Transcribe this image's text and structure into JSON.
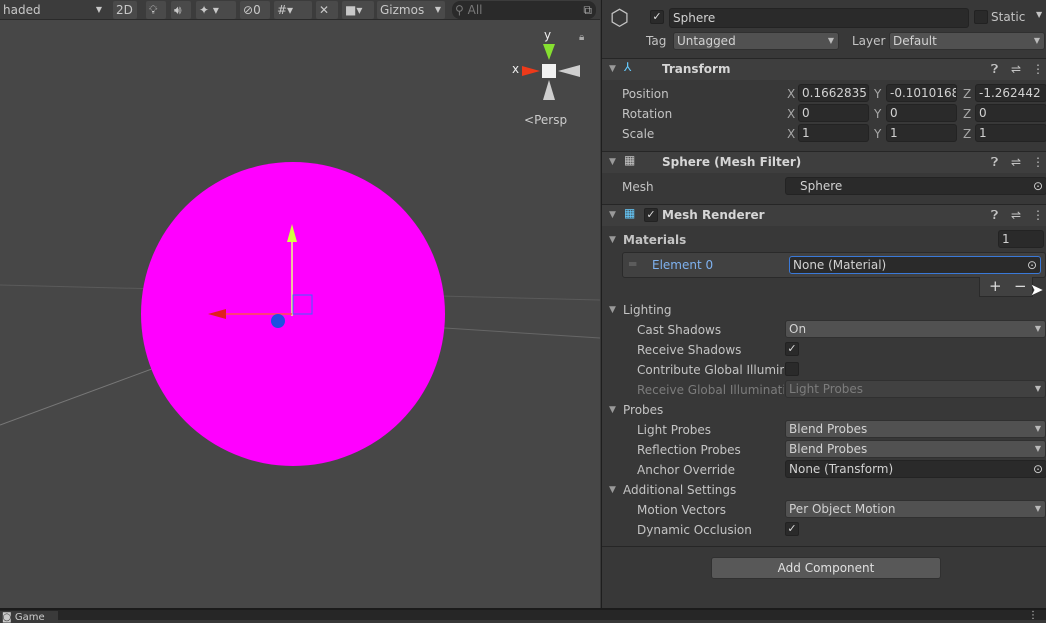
{
  "toolbar": {
    "shading": "haded",
    "mode_2d": "2D",
    "hidden_count": "0",
    "gizmos": "Gizmos",
    "search_placeholder": "All"
  },
  "scene": {
    "gizmo_y": "y",
    "gizmo_x": "x",
    "projection": "Persp",
    "sphere_color": "#ff00ff"
  },
  "object": {
    "active": true,
    "name": "Sphere",
    "static_label": "Static",
    "static": false,
    "tag_label": "Tag",
    "tag": "Untagged",
    "layer_label": "Layer",
    "layer": "Default"
  },
  "transform": {
    "title": "Transform",
    "rows": [
      {
        "label": "Position",
        "x": "0.1662835",
        "y": "-0.1010168",
        "z": "-1.262442"
      },
      {
        "label": "Rotation",
        "x": "0",
        "y": "0",
        "z": "0"
      },
      {
        "label": "Scale",
        "x": "1",
        "y": "1",
        "z": "1"
      }
    ],
    "axis_x": "X",
    "axis_y": "Y",
    "axis_z": "Z"
  },
  "mesh_filter": {
    "title": "Sphere (Mesh Filter)",
    "mesh_label": "Mesh",
    "mesh": "Sphere"
  },
  "mesh_renderer": {
    "title": "Mesh Renderer",
    "enabled": true,
    "materials_label": "Materials",
    "materials_count": "1",
    "element_label": "Element 0",
    "element_value": "None (Material)",
    "add": "+",
    "remove": "−",
    "lighting_label": "Lighting",
    "cast_shadows_label": "Cast Shadows",
    "cast_shadows": "On",
    "receive_shadows_label": "Receive Shadows",
    "receive_shadows": true,
    "contribute_gi_label": "Contribute Global Illuminat",
    "contribute_gi": false,
    "receive_gi_label": "Receive Global Illuminatio",
    "receive_gi": "Light Probes",
    "probes_label": "Probes",
    "light_probes_label": "Light Probes",
    "light_probes": "Blend Probes",
    "reflection_probes_label": "Reflection Probes",
    "reflection_probes": "Blend Probes",
    "anchor_override_label": "Anchor Override",
    "anchor_override": "None (Transform)",
    "additional_label": "Additional Settings",
    "motion_vectors_label": "Motion Vectors",
    "motion_vectors": "Per Object Motion",
    "dynamic_occlusion_label": "Dynamic Occlusion",
    "dynamic_occlusion": true
  },
  "add_component": "Add Component",
  "bottom": {
    "tab": "Game"
  }
}
